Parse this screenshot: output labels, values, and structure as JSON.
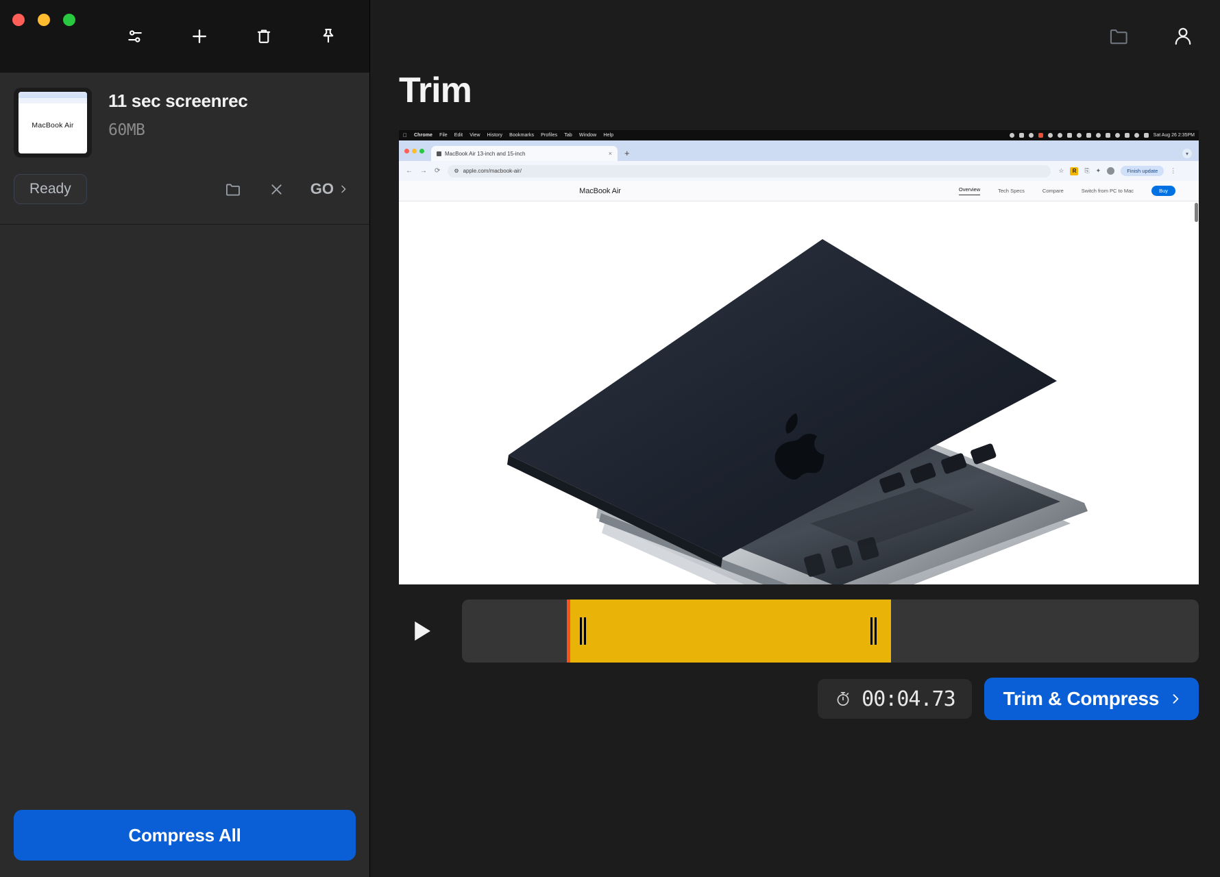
{
  "window": {
    "traffic_lights": [
      "close",
      "minimize",
      "zoom"
    ],
    "accent_blue": "#0a5fd6",
    "selection_yellow": "#eab308",
    "playhead_red": "#f4541f"
  },
  "sidebar": {
    "toolbar": [
      {
        "name": "settings-sliders-icon",
        "label": "Settings"
      },
      {
        "name": "add-icon",
        "label": "Add"
      },
      {
        "name": "trash-icon",
        "label": "Delete"
      },
      {
        "name": "pin-icon",
        "label": "Pin"
      }
    ],
    "file": {
      "thumbnail_label": "MacBook Air",
      "title": "11 sec screenrec",
      "size": "60MB",
      "status": "Ready",
      "actions": [
        {
          "name": "reveal-in-folder-icon",
          "label": "Folder"
        },
        {
          "name": "remove-icon",
          "label": "Remove"
        }
      ],
      "go_label": "GO"
    },
    "compress_all_label": "Compress All"
  },
  "header": {
    "folder_icon": "folder-icon",
    "account_icon": "account-icon"
  },
  "main": {
    "title": "Trim",
    "duration": "00:04.73",
    "timer_icon": "stopwatch-icon",
    "trim_button_label": "Trim & Compress",
    "play_button": "play-icon"
  },
  "preview": {
    "macos_menubar": {
      "apple": "",
      "items": [
        "Chrome",
        "File",
        "Edit",
        "View",
        "History",
        "Bookmarks",
        "Profiles",
        "Tab",
        "Window",
        "Help"
      ],
      "clock": "Sat Aug 26  2:35PM"
    },
    "chrome": {
      "tab_title": "MacBook Air 13-inch and 15-inch",
      "new_tab": "+",
      "url": "apple.com/macbook-air/",
      "update_pill": "Finish update",
      "extension_badge": "R"
    },
    "apple_page": {
      "brand": "MacBook Air",
      "nav_links": [
        "Overview",
        "Tech Specs",
        "Compare",
        "Switch from PC to Mac"
      ],
      "active_link": "Overview",
      "buy_label": "Buy"
    }
  }
}
